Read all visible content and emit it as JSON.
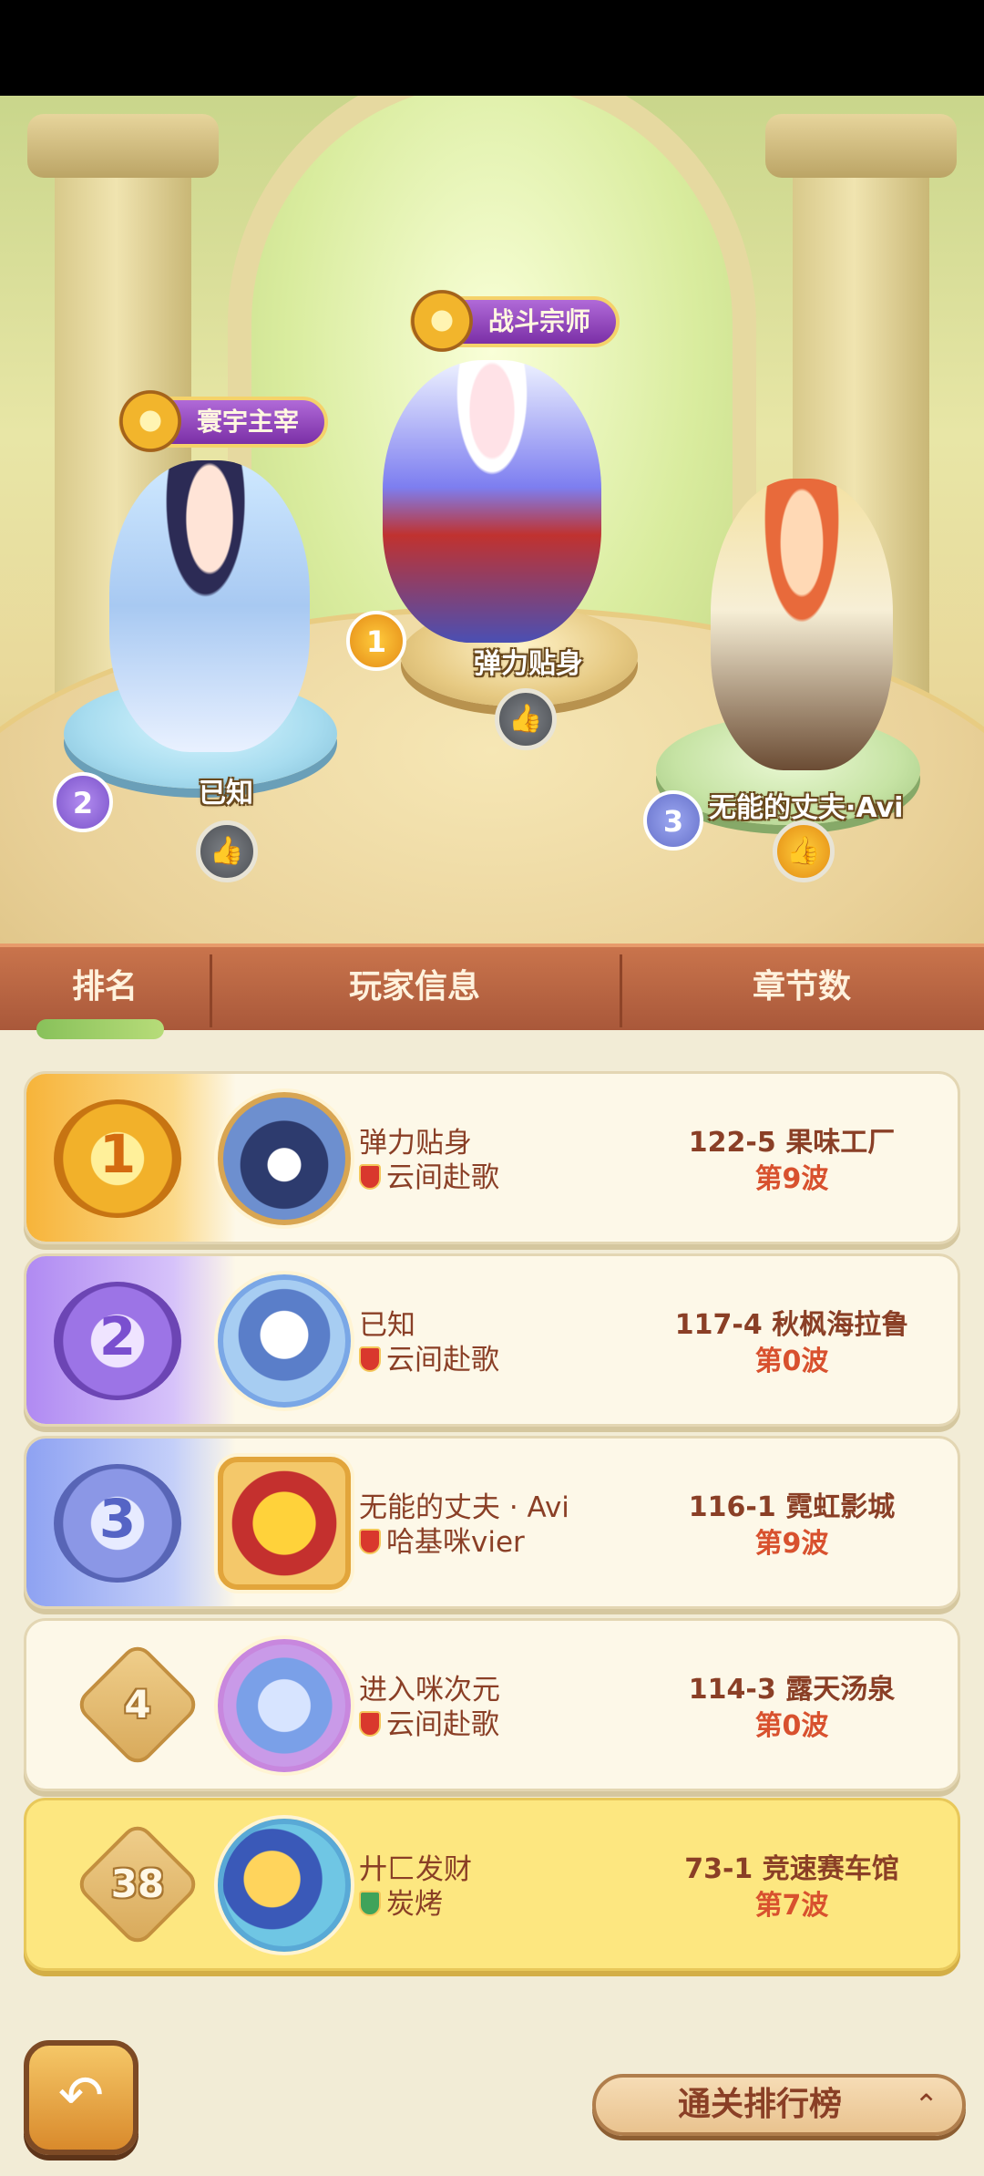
{
  "podium": {
    "first": {
      "title": "战斗宗师",
      "name": "弹力贴身",
      "rank": "1"
    },
    "second": {
      "title": "寰宇主宰",
      "name": "已知",
      "rank": "2"
    },
    "third": {
      "name": "无能的丈夫·Avi",
      "rank": "3"
    },
    "like_icon": "thumbs-up-icon"
  },
  "header": {
    "rank": "排名",
    "player_info": "玩家信息",
    "chapters": "章节数"
  },
  "rows": [
    {
      "rank": "1",
      "name": "弹力贴身",
      "guild": "云间赴歌",
      "chapter": "122-5 果味工厂",
      "wave": "第9波"
    },
    {
      "rank": "2",
      "name": "已知",
      "guild": "云间赴歌",
      "chapter": "117-4 秋枫海拉鲁",
      "wave": "第0波"
    },
    {
      "rank": "3",
      "name": "无能的丈夫 · Avi",
      "guild": "哈基咪vier",
      "chapter": "116-1 霓虹影城",
      "wave": "第9波"
    },
    {
      "rank": "4",
      "name": "进入咪次元",
      "guild": "云间赴歌",
      "chapter": "114-3 露天汤泉",
      "wave": "第0波"
    },
    {
      "rank": "38",
      "name": "廾匚发财",
      "guild": "炭烤",
      "chapter": "73-1 竞速赛车馆",
      "wave": "第7波"
    }
  ],
  "footer": {
    "back_icon": "back-arrow-icon",
    "board_label": "通关排行榜",
    "arrow": "⌃"
  },
  "colors": {
    "header": "#b4603f",
    "self_row": "#fde780",
    "text": "#8a3f26",
    "wave": "#d8512e"
  }
}
